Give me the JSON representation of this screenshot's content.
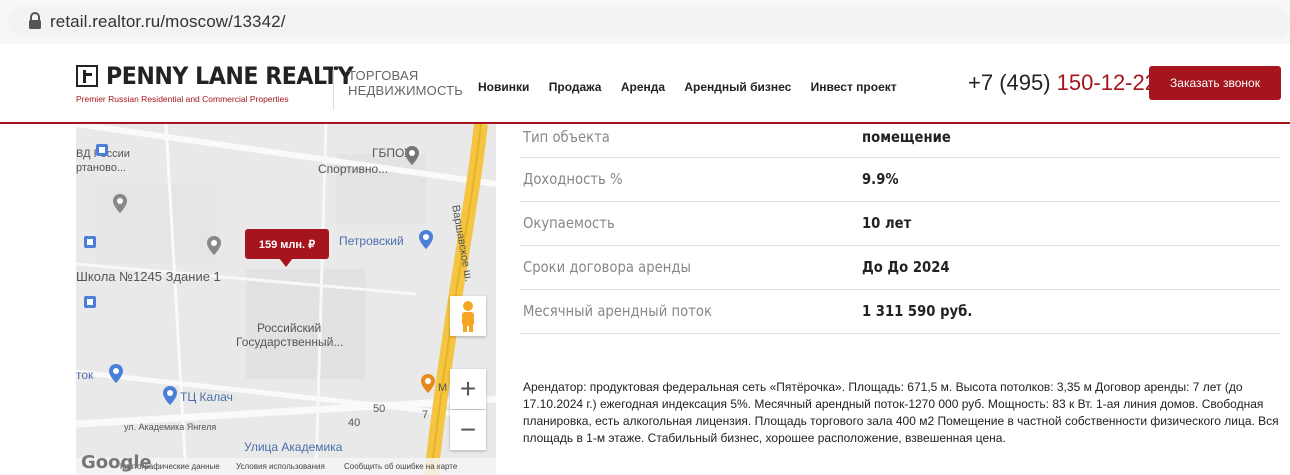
{
  "browser": {
    "url": "retail.realtor.ru/moscow/13342/"
  },
  "header": {
    "logo_name": "PENNY LANE REALTY",
    "logo_tagline": "Premier Russian Residential and Commercial Properties",
    "category_line1": "ТОРГОВАЯ",
    "category_line2": "НЕДВИЖИМОСТЬ",
    "nav": [
      "Новинки",
      "Продажа",
      "Аренда",
      "Арендный бизнес",
      "Инвест проект"
    ],
    "phone_prefix": "+7 (495) ",
    "phone_number": "150-12-22",
    "call_button": "Заказать звонок",
    "accent_color": "#a4151e"
  },
  "map": {
    "price_label": "159 млн. ₽",
    "labels": {
      "gbpou": "ГБПОУ",
      "sportivno": "Спортивно...",
      "vd_rossii": "ВД России",
      "rtanovo": "ртаново...",
      "petrovsky": "Петровский",
      "school": "Школа №1245 Здание 1",
      "varshavskoe": "Варшавское ш.",
      "rossiysky1": "Российский",
      "rossiysky2": "Государственный...",
      "tok": "ток",
      "tc_kalach": "ТЦ Калач",
      "akademika_yangelya": "ул. Академика Янгеля",
      "ulitsa_akademika": "Улица Академика",
      "num40": "40",
      "num50": "50",
      "num7": "7",
      "m": "М"
    },
    "footer": {
      "google": "Google",
      "map_data": "Картографические данные",
      "terms": "Условия использования",
      "report": "Сообщить об ошибке на карте"
    },
    "zoom_in": "+",
    "zoom_out": "−"
  },
  "properties": [
    {
      "label": "Тип объекта",
      "value": "помещение"
    },
    {
      "label": "Доходность %",
      "value": "9.9%"
    },
    {
      "label": "Окупаемость",
      "value": "10 лет"
    },
    {
      "label": "Сроки договора аренды",
      "value": "До До 2024"
    },
    {
      "label": "Месячный арендный поток",
      "value": "1 311 590 руб."
    }
  ],
  "description": "Арендатор: продуктовая федеральная сеть «Пятёрочка».  Площадь: 671,5 м.  Высота потолков: 3,35 м Договор аренды: 7 лет (до 17.10.2024 г.) ежегодная индексация 5%.   Месячный арендный поток-1270 000 руб. Мощность: 83 к Вт. 1-ая линия домов. Свободная планировка, есть алкогольная лицензия.   Площадь торгового зала 400 м2 Помещение в частной собственности физического лица. Вся площадь в 1-м этаже. Стабильный бизнес, хорошее расположение, взвешенная цена."
}
